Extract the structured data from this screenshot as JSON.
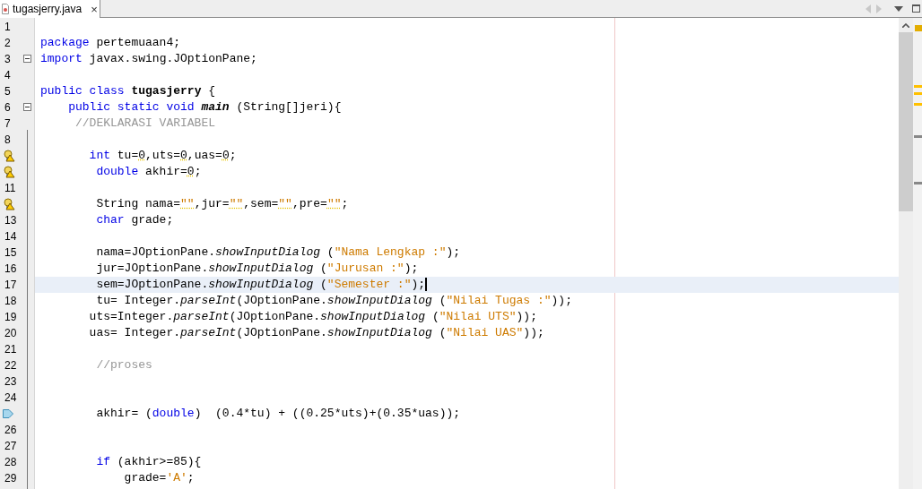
{
  "tabs": [
    {
      "label": "tugasjerry.java",
      "close": "×",
      "selected": true
    }
  ],
  "editor": {
    "lines": [
      {
        "number": "1",
        "current": false
      },
      {
        "number": "2",
        "current": false,
        "tokens": [
          {
            "kind": "keyword",
            "text": "package"
          },
          {
            "kind": "plain",
            "text": " pertemuaan4;"
          }
        ]
      },
      {
        "number": "3",
        "current": false,
        "kind": "fold",
        "tokens": [
          {
            "kind": "keyword",
            "text": "import"
          },
          {
            "kind": "plain",
            "text": " javax.swing.JOptionPane;"
          }
        ]
      },
      {
        "number": "4",
        "current": false
      },
      {
        "number": "5",
        "current": false,
        "tokens": [
          {
            "kind": "keyword",
            "text": "public class"
          },
          {
            "kind": "bold",
            "text": " tugasjerry"
          },
          {
            "kind": "plain",
            "text": " {"
          }
        ]
      },
      {
        "number": "6",
        "current": false,
        "kind": "fold",
        "tokens": [
          {
            "kind": "keyword",
            "text": "    public static void"
          },
          {
            "kind": "bold_italic",
            "text": " main"
          },
          {
            "kind": "plain",
            "text": " (String[]jeri){"
          }
        ]
      },
      {
        "number": "7",
        "current": false,
        "tokens": [
          {
            "kind": "comment",
            "text": "     //DEKLARASI VARIABEL"
          }
        ]
      },
      {
        "number": "8",
        "current": false
      },
      {
        "current": false,
        "kind": "warning",
        "tokens": [
          {
            "kind": "keyword",
            "text": "       int"
          },
          {
            "kind": "plain",
            "text": " tu="
          },
          {
            "kind": "warned_plain",
            "text": "0"
          },
          {
            "kind": "plain",
            "text": ",uts="
          },
          {
            "kind": "warned_plain",
            "text": "0"
          },
          {
            "kind": "plain",
            "text": ",uas="
          },
          {
            "kind": "warned_plain",
            "text": "0"
          },
          {
            "kind": "plain",
            "text": ";"
          }
        ]
      },
      {
        "current": false,
        "kind": "warning",
        "tokens": [
          {
            "kind": "keyword",
            "text": "        double"
          },
          {
            "kind": "plain",
            "text": " akhir="
          },
          {
            "kind": "warned_plain",
            "text": "0"
          },
          {
            "kind": "plain",
            "text": ";"
          }
        ]
      },
      {
        "number": "11",
        "current": false
      },
      {
        "current": false,
        "kind": "warning",
        "tokens": [
          {
            "kind": "plain",
            "text": "        String nama="
          },
          {
            "kind": "warned_string",
            "text": "\"\""
          },
          {
            "kind": "plain",
            "text": ",jur="
          },
          {
            "kind": "warned_string",
            "text": "\"\""
          },
          {
            "kind": "plain",
            "text": ",sem="
          },
          {
            "kind": "warned_string",
            "text": "\"\""
          },
          {
            "kind": "plain",
            "text": ",pre="
          },
          {
            "kind": "warned_string",
            "text": "\"\""
          },
          {
            "kind": "plain",
            "text": ";"
          }
        ]
      },
      {
        "number": "13",
        "current": false,
        "tokens": [
          {
            "kind": "keyword",
            "text": "        char"
          },
          {
            "kind": "plain",
            "text": " grade;"
          }
        ]
      },
      {
        "number": "14",
        "current": false
      },
      {
        "number": "15",
        "current": false,
        "tokens": [
          {
            "kind": "plain",
            "text": "        nama=JOptionPane."
          },
          {
            "kind": "italic",
            "text": "showInputDialog"
          },
          {
            "kind": "plain",
            "text": " ("
          },
          {
            "kind": "string",
            "text": "\"Nama Lengkap :\""
          },
          {
            "kind": "plain",
            "text": ");"
          }
        ]
      },
      {
        "number": "16",
        "current": false,
        "tokens": [
          {
            "kind": "plain",
            "text": "        jur=JOptionPane."
          },
          {
            "kind": "italic",
            "text": "showInputDialog"
          },
          {
            "kind": "plain",
            "text": " ("
          },
          {
            "kind": "string",
            "text": "\"Jurusan :\""
          },
          {
            "kind": "plain",
            "text": ");"
          }
        ]
      },
      {
        "number": "17",
        "current": true,
        "tokens": [
          {
            "kind": "plain",
            "text": "        sem=JOptionPane."
          },
          {
            "kind": "italic",
            "text": "showInputDialog"
          },
          {
            "kind": "plain",
            "text": " ("
          },
          {
            "kind": "string",
            "text": "\"Semester :\""
          },
          {
            "kind": "plain",
            "text": ");"
          }
        ]
      },
      {
        "number": "18",
        "current": false,
        "tokens": [
          {
            "kind": "plain",
            "text": "        tu= Integer."
          },
          {
            "kind": "italic",
            "text": "parseInt"
          },
          {
            "kind": "plain",
            "text": "(JOptionPane."
          },
          {
            "kind": "italic",
            "text": "showInputDialog"
          },
          {
            "kind": "plain",
            "text": " ("
          },
          {
            "kind": "string",
            "text": "\"Nilai Tugas :\""
          },
          {
            "kind": "plain",
            "text": "));"
          }
        ]
      },
      {
        "number": "19",
        "current": false,
        "tokens": [
          {
            "kind": "plain",
            "text": "       uts=Integer."
          },
          {
            "kind": "italic",
            "text": "parseInt"
          },
          {
            "kind": "plain",
            "text": "(JOptionPane."
          },
          {
            "kind": "italic",
            "text": "showInputDialog"
          },
          {
            "kind": "plain",
            "text": " ("
          },
          {
            "kind": "string",
            "text": "\"Nilai UTS\""
          },
          {
            "kind": "plain",
            "text": "));"
          }
        ]
      },
      {
        "number": "20",
        "current": false,
        "tokens": [
          {
            "kind": "plain",
            "text": "       uas= Integer."
          },
          {
            "kind": "italic",
            "text": "parseInt"
          },
          {
            "kind": "plain",
            "text": "(JOptionPane."
          },
          {
            "kind": "italic",
            "text": "showInputDialog"
          },
          {
            "kind": "plain",
            "text": " ("
          },
          {
            "kind": "string",
            "text": "\"Nilai UAS\""
          },
          {
            "kind": "plain",
            "text": "));"
          }
        ]
      },
      {
        "number": "21",
        "current": false
      },
      {
        "number": "22",
        "current": false,
        "tokens": [
          {
            "kind": "comment",
            "text": "        //proses"
          }
        ]
      },
      {
        "number": "23",
        "current": false
      },
      {
        "number": "24",
        "current": false
      },
      {
        "current": false,
        "kind": "arrow",
        "tokens": [
          {
            "kind": "plain",
            "text": "        akhir= ("
          },
          {
            "kind": "keyword",
            "text": "double"
          },
          {
            "kind": "plain",
            "text": ")  (0.4*tu) + ((0.25*uts)+(0.35*uas));"
          }
        ]
      },
      {
        "number": "26",
        "current": false
      },
      {
        "number": "27",
        "current": false
      },
      {
        "number": "28",
        "current": false,
        "tokens": [
          {
            "kind": "keyword",
            "text": "        if"
          },
          {
            "kind": "plain",
            "text": " (akhir>=85){"
          }
        ]
      },
      {
        "number": "29",
        "current": false,
        "tokens": [
          {
            "kind": "plain",
            "text": "            grade="
          },
          {
            "kind": "string",
            "text": "'A'"
          },
          {
            "kind": "plain",
            "text": ";"
          }
        ]
      }
    ]
  }
}
